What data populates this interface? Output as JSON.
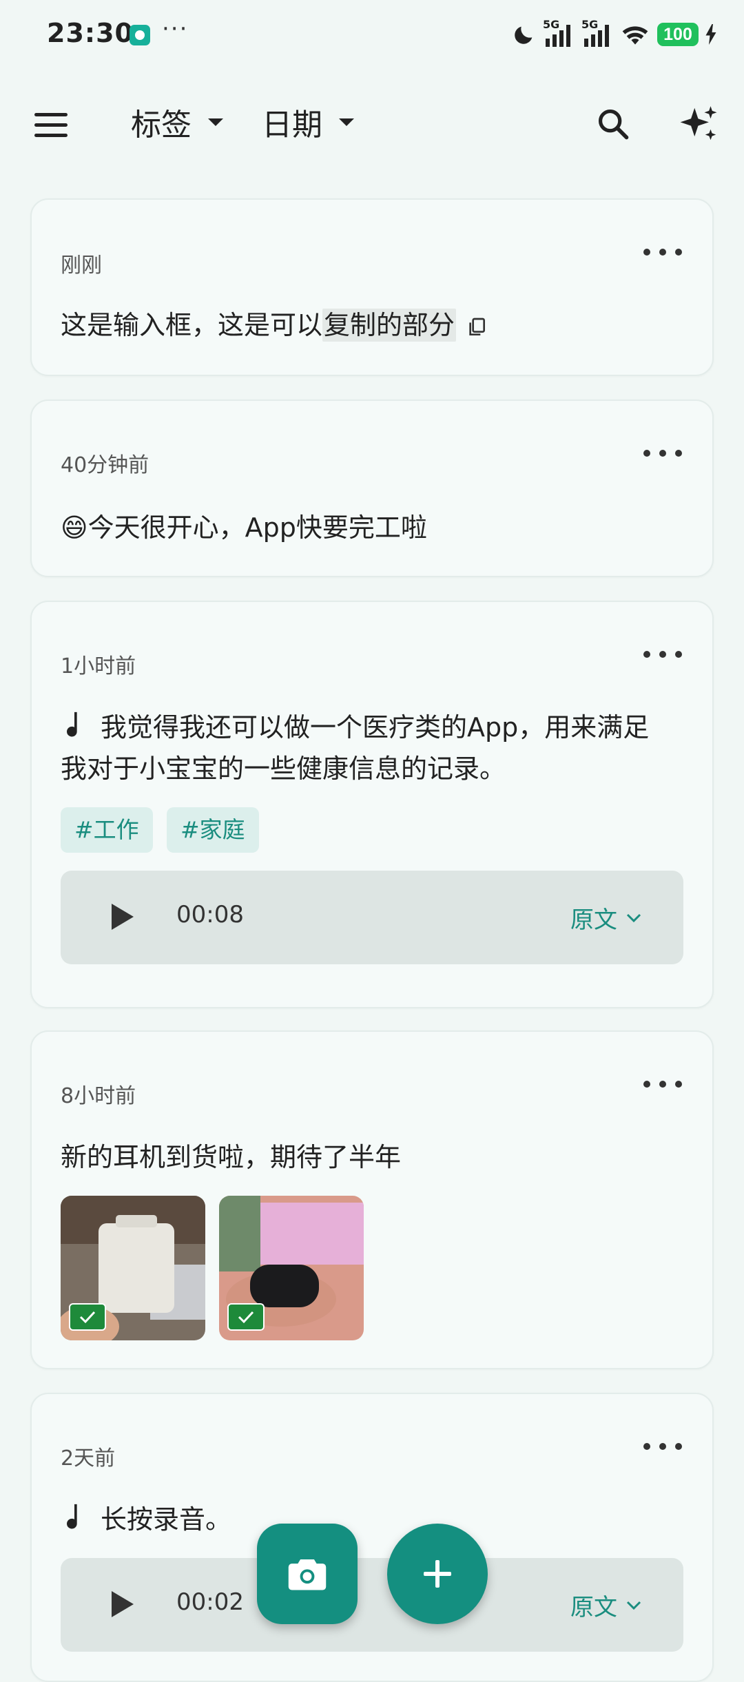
{
  "status_bar": {
    "time": "23:30",
    "dots": "···",
    "signal_1": "5G",
    "signal_2": "5G",
    "battery": "100"
  },
  "app_bar": {
    "menu_icon": "hamburger-menu-icon",
    "filter_tag_label": "标签",
    "filter_date_label": "日期",
    "search_icon": "search-icon",
    "ai_icon": "sparkle-icon"
  },
  "notes": [
    {
      "time": "刚刚",
      "text_before": "这是输入框，这是可以",
      "text_highlight": "复制的部分"
    },
    {
      "time": "40分钟前",
      "emoji": "😄",
      "text": "今天很开心，App快要完工啦"
    },
    {
      "time": "1小时前",
      "text": "我觉得我还可以做一个医疗类的App，用来满足我对于小宝宝的一些健康信息的记录。",
      "tags": [
        "#工作",
        "#家庭"
      ],
      "audio": {
        "duration": "00:08",
        "transcript_label": "原文"
      }
    },
    {
      "time": "8小时前",
      "text": "新的耳机到货啦，期待了半年",
      "images": [
        {
          "checked": true,
          "desc": "white headphone case"
        },
        {
          "checked": true,
          "desc": "black sony earbuds case"
        }
      ]
    },
    {
      "time": "2天前",
      "text": "长按录音。",
      "audio": {
        "duration": "00:02",
        "transcript_label": "原文"
      }
    }
  ],
  "fab": {
    "camera_icon": "camera-icon",
    "add_icon": "plus-icon"
  },
  "colors": {
    "accent": "#148f80",
    "tag_bg": "#dcefec",
    "background": "#f1f7f5"
  }
}
